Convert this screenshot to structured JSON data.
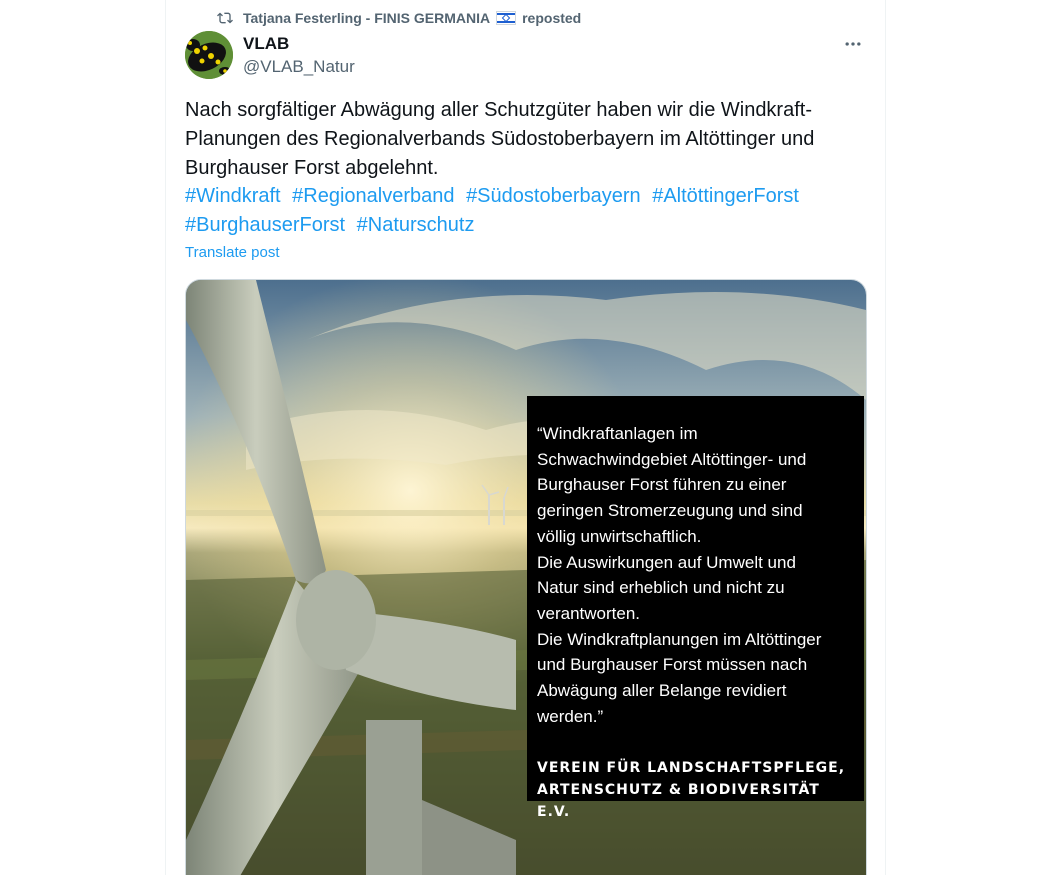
{
  "repost": {
    "icon": "repost-icon",
    "user_name": "Tatjana Festerling - FINIS GERMANIA",
    "flag": "israel-flag-icon",
    "label": "reposted"
  },
  "post": {
    "author_name": "VLAB",
    "author_handle": "@VLAB_Natur",
    "more_icon": "more-icon",
    "text": "Nach sorgfältiger Abwägung aller Schutzgüter haben wir die Windkraft-Planungen des Regionalverbands Südostoberbayern im Altöttinger und Burghauser Forst abgelehnt.",
    "hashtags": [
      "#Windkraft",
      "#Regionalverband",
      "#Südostoberbayern",
      "#AltöttingerForst",
      "#BurghauserForst",
      "#Naturschutz"
    ],
    "translate_label": "Translate post"
  },
  "media": {
    "quote": "“Windkraftanlagen im\nSchwachwindgebiet Altöttinger- und\nBurghauser Forst führen zu einer\ngeringen Stromerzeugung und sind\nvöllig unwirtschaftlich.\nDie Auswirkungen auf Umwelt und\nNatur sind erheblich und nicht zu\nverantworten.\nDie Windkraftplanungen im Altöttinger\nund Burghauser Forst müssen nach\nAbwägung aller Belange revidiert\nwerden.”",
    "organization": "VEREIN FÜR LANDSCHAFTSPFLEGE,\nARTENSCHUTZ & BIODIVERSITÄT E.V."
  },
  "colors": {
    "link": "#1d9bf0",
    "text": "#0f1419",
    "secondary": "#536471"
  }
}
